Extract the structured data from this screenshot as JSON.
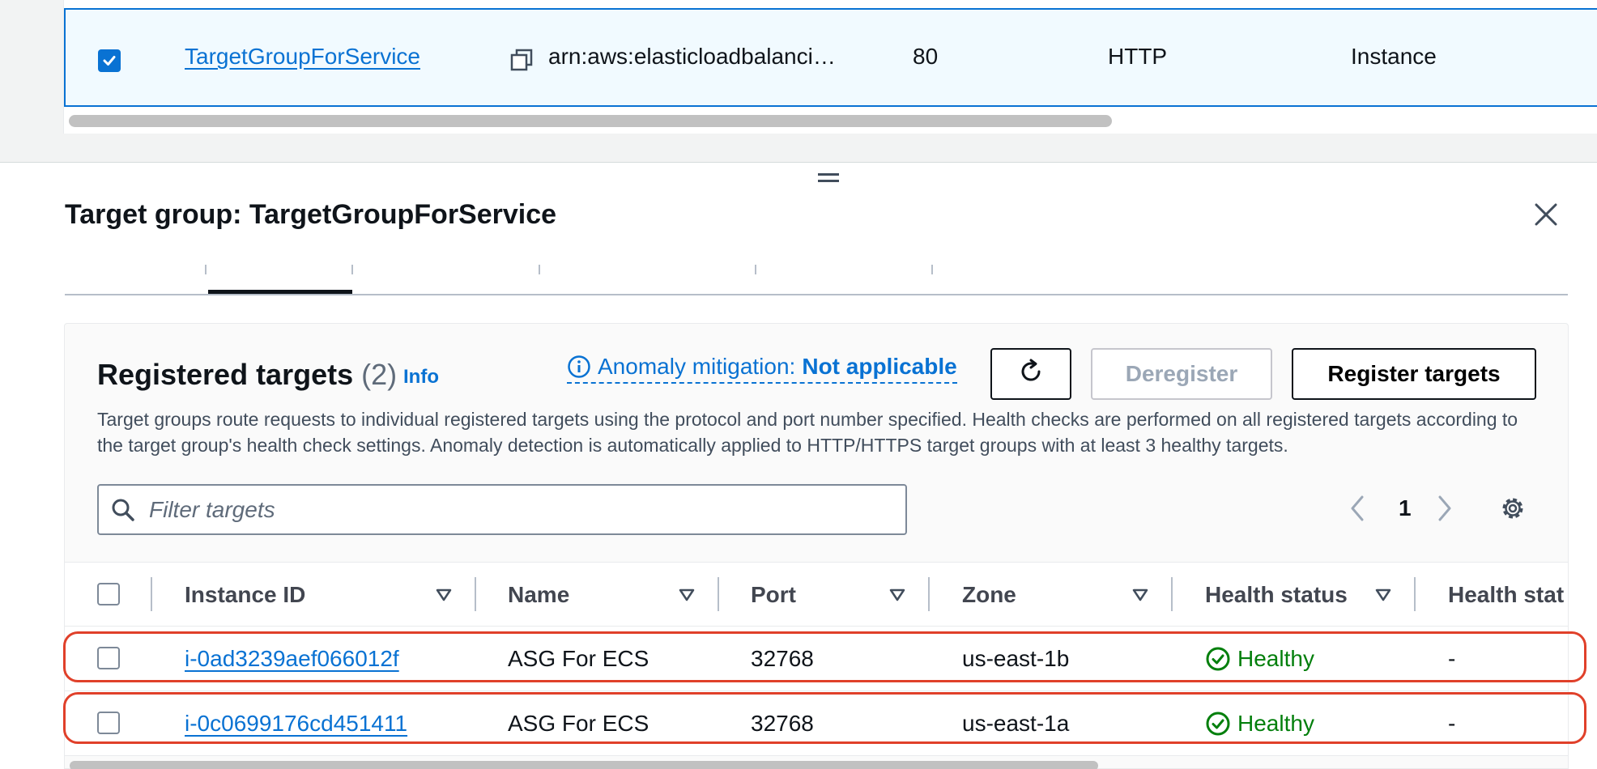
{
  "selected_row": {
    "name": "TargetGroupForService",
    "arn": "arn:aws:elasticloadbalanci…",
    "port": "80",
    "protocol": "HTTP",
    "target_type": "Instance"
  },
  "panel": {
    "title": "Target group: TargetGroupForService"
  },
  "registered_targets": {
    "title": "Registered targets",
    "count": "(2)",
    "info_label": "Info",
    "anomaly_label": "Anomaly mitigation:",
    "anomaly_value": "Not applicable",
    "deregister_label": "Deregister",
    "register_label": "Register targets",
    "description": "Target groups route requests to individual registered targets using the protocol and port number specified. Health checks are performed on all registered targets according to the target group's health check settings. Anomaly detection is automatically applied to HTTP/HTTPS target groups with at least 3 healthy targets.",
    "filter_placeholder": "Filter targets",
    "current_page": "1"
  },
  "table": {
    "columns": [
      "Instance ID",
      "Name",
      "Port",
      "Zone",
      "Health status",
      "Health stat"
    ],
    "rows": [
      {
        "instance_id": "i-0ad3239aef066012f",
        "name": "ASG For ECS",
        "port": "32768",
        "zone": "us-east-1b",
        "health": "Healthy",
        "health_detail": "-"
      },
      {
        "instance_id": "i-0c0699176cd451411",
        "name": "ASG For ECS",
        "port": "32768",
        "zone": "us-east-1a",
        "health": "Healthy",
        "health_detail": "-"
      }
    ]
  },
  "colors": {
    "link": "#0972d3",
    "healthy": "#037f0c",
    "highlight": "#e0402a",
    "selected_bg": "#f1faff"
  },
  "icons": [
    "checkbox-checked-icon",
    "copy-icon",
    "drag-handle-icon",
    "close-icon",
    "info-circle-icon",
    "refresh-icon",
    "search-icon",
    "chevron-left-icon",
    "chevron-right-icon",
    "gear-icon",
    "sort-down-icon",
    "status-positive-icon"
  ]
}
